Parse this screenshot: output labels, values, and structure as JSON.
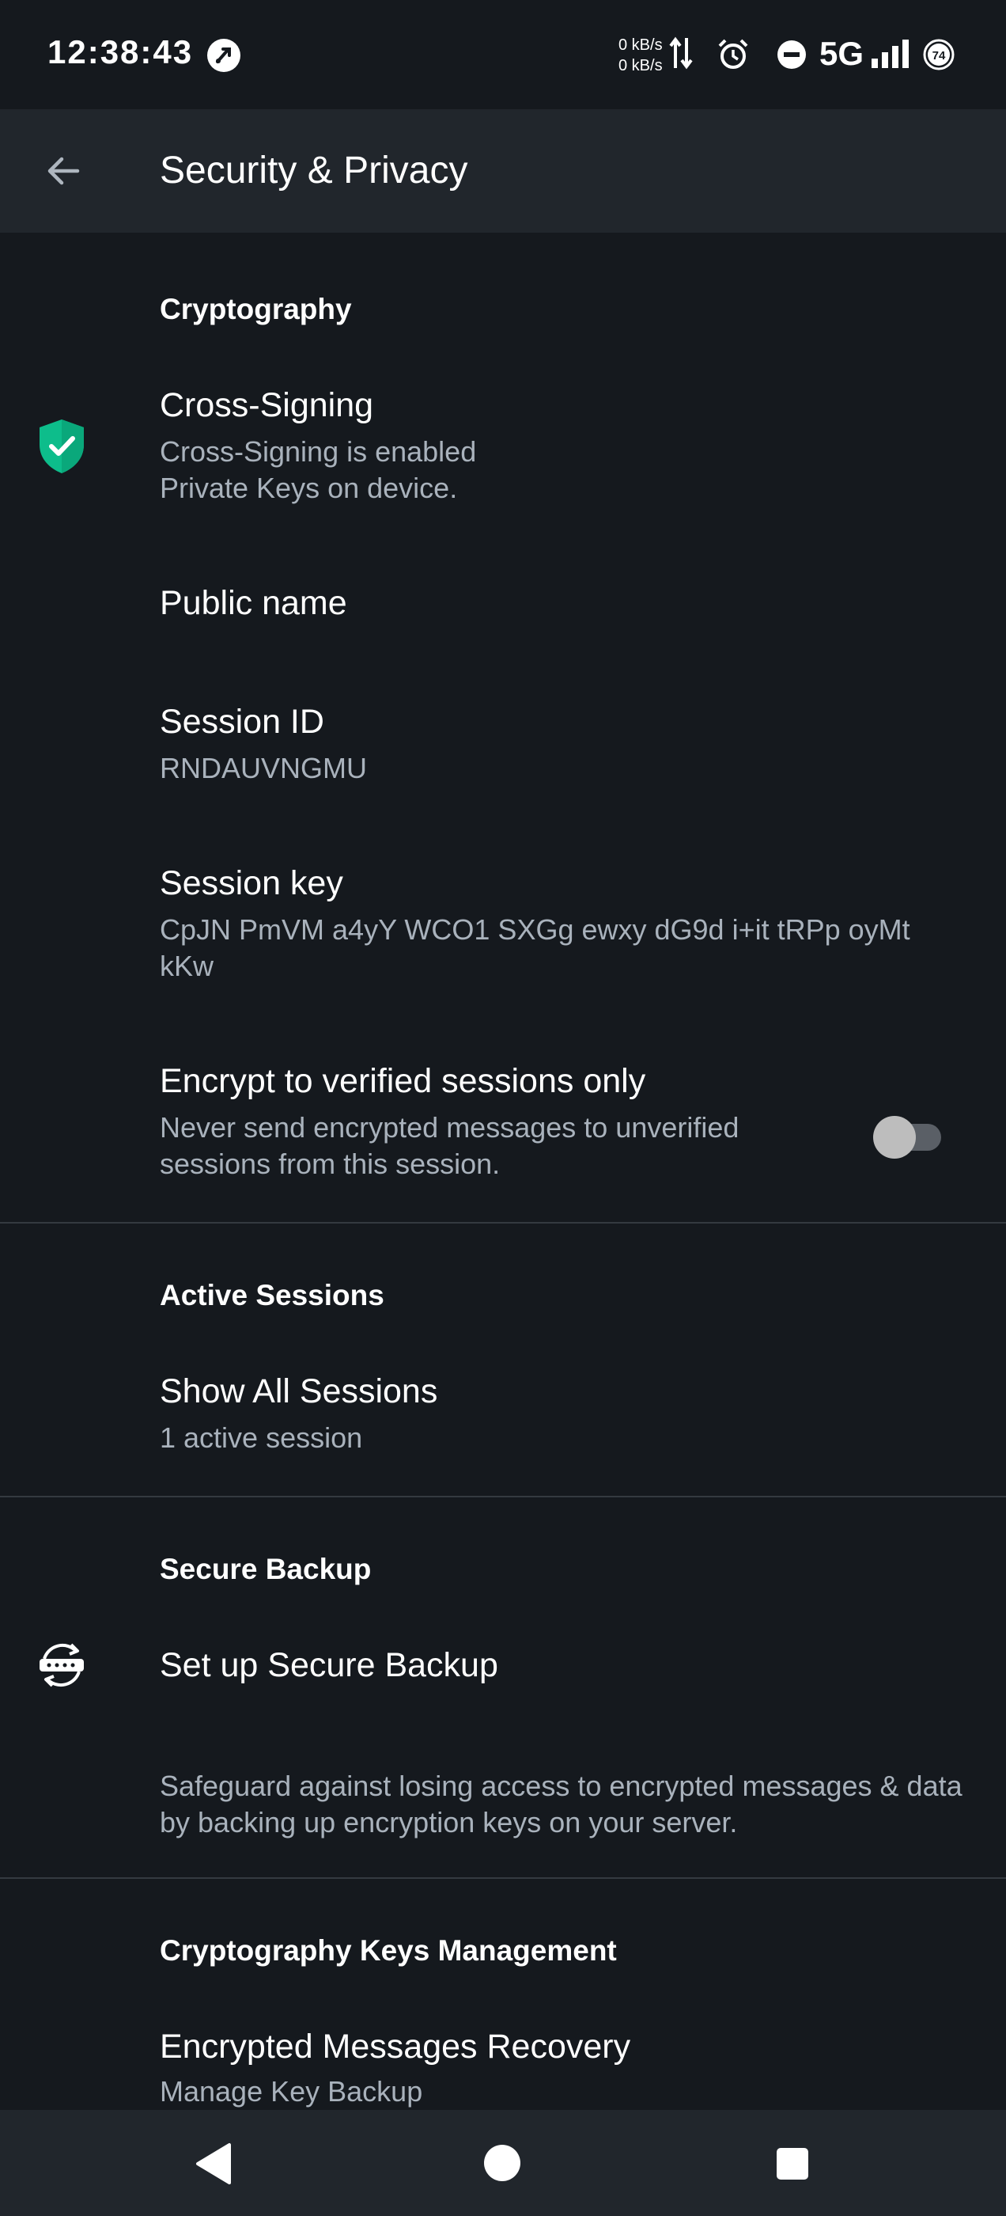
{
  "status_bar": {
    "time": "12:38:43",
    "net_up": "0 kB/s",
    "net_down": "0 kB/s",
    "network_type": "5G",
    "battery": "74"
  },
  "toolbar": {
    "title": "Security & Privacy"
  },
  "sections": {
    "cryptography": {
      "header": "Cryptography",
      "cross_signing": {
        "title": "Cross-Signing",
        "summary_line1": "Cross-Signing is enabled",
        "summary_line2": "Private Keys on device."
      },
      "public_name": {
        "title": "Public name"
      },
      "session_id": {
        "title": "Session ID",
        "value": "RNDAUVNGMU"
      },
      "session_key": {
        "title": "Session key",
        "value": "CpJN PmVM a4yY WCO1 SXGg ewxy dG9d i+it tRPp oyMt kKw"
      },
      "encrypt_verified": {
        "title": "Encrypt to verified sessions only",
        "summary": "Never send encrypted messages to unverified sessions from this session.",
        "enabled": false
      }
    },
    "active_sessions": {
      "header": "Active Sessions",
      "show_all": {
        "title": "Show All Sessions",
        "summary": "1 active session"
      }
    },
    "secure_backup": {
      "header": "Secure Backup",
      "setup": {
        "title": "Set up Secure Backup"
      },
      "info": "Safeguard against losing access to encrypted messages & data by backing up encryption keys on your server."
    },
    "keys_management": {
      "header": "Cryptography Keys Management",
      "recovery": {
        "title": "Encrypted Messages Recovery",
        "summary": "Manage Key Backup"
      }
    }
  },
  "colors": {
    "background": "#15191e",
    "toolbar": "#21262c",
    "shield": "#0dbd8b",
    "summary_text": "#a9b2bc"
  },
  "icons": {
    "back": "arrow-back-icon",
    "cross_signing": "shield-check-icon",
    "backup": "key-backup-icon"
  }
}
